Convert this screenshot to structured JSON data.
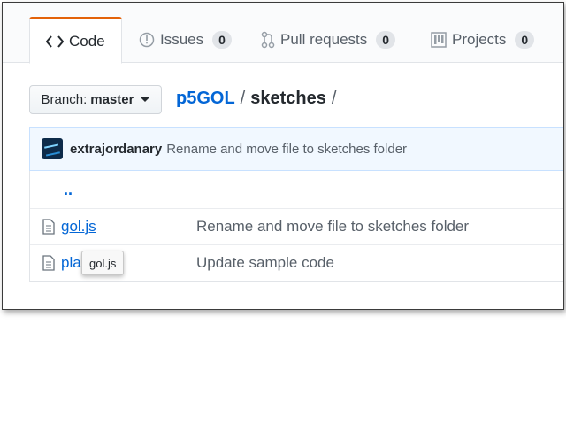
{
  "tabs": [
    {
      "label": "Code",
      "icon": "code-icon",
      "active": true
    },
    {
      "label": "Issues",
      "icon": "issue-icon",
      "count": "0"
    },
    {
      "label": "Pull requests",
      "icon": "pull-request-icon",
      "count": "0"
    },
    {
      "label": "Projects",
      "icon": "project-icon",
      "count": "0"
    }
  ],
  "branch": {
    "prefix": "Branch:",
    "name": "master"
  },
  "breadcrumb": {
    "repo": "p5GOL",
    "separator": "/",
    "dir": "sketches",
    "trailing": "/"
  },
  "latest_commit": {
    "author": "extrajordanary",
    "message": "Rename and move file to sketches folder"
  },
  "files": {
    "updir": "..",
    "rows": [
      {
        "name": "gol.js",
        "message": "Rename and move file to sketches folder"
      },
      {
        "name": "pla",
        "message": "Update sample code"
      }
    ]
  },
  "tooltip": {
    "text": "gol.js"
  },
  "colors": {
    "accent": "#e36209",
    "link": "#0366d6",
    "commit_bg": "#f1f8ff"
  }
}
